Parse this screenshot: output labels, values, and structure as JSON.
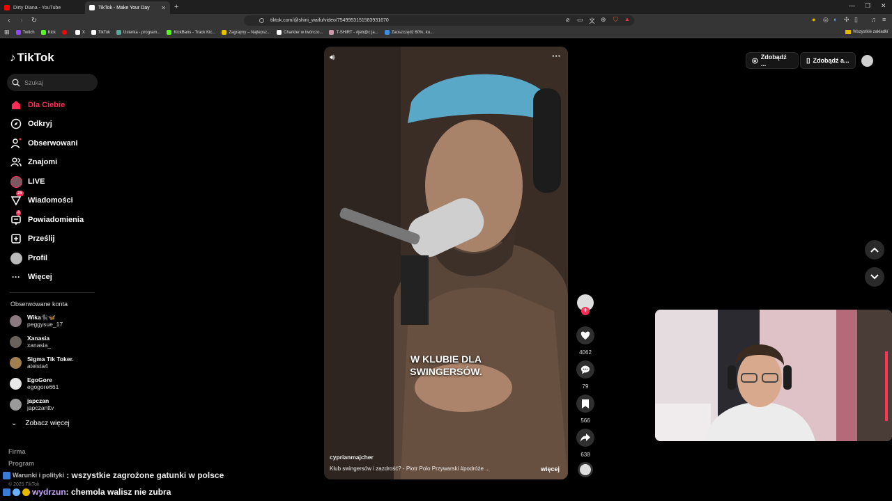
{
  "browser": {
    "tabs": [
      {
        "title": "Dirty Diana - YouTube",
        "active": false,
        "color": "#ff0000"
      },
      {
        "title": "TikTok - Make Your Day",
        "active": true,
        "color": "#ffffff"
      }
    ],
    "url": "tiktok.com/@shini_waifu/video/7549953151583931670",
    "bookmarks": [
      {
        "label": "Twitch",
        "color": "#9146ff"
      },
      {
        "label": "Kick",
        "color": "#53fc18"
      },
      {
        "label": "",
        "color": "#ff0000"
      },
      {
        "label": "X",
        "color": "#ffffff"
      },
      {
        "label": "TikTok",
        "color": "#ffffff"
      },
      {
        "label": "Usterka - program...",
        "color": "#5a9"
      },
      {
        "label": "KickBans - Track Kic...",
        "color": "#53fc18"
      },
      {
        "label": "Zagrajmy – Najlepsz...",
        "color": "#e6c200"
      },
      {
        "label": "Charkter w twórczo...",
        "color": "#ffffff"
      },
      {
        "label": "T-SHIRT - #jeb@c ja...",
        "color": "#c9a"
      },
      {
        "label": "Zaoszczędź 60%, ku...",
        "color": "#3a8ee6"
      }
    ],
    "bookmarks_folder": "Wszystkie zakładki"
  },
  "sidebar": {
    "logo": "TikTok",
    "search_placeholder": "Szukaj",
    "nav": [
      {
        "label": "Dla Ciebie",
        "icon": "home-icon",
        "active": true
      },
      {
        "label": "Odkryj",
        "icon": "compass-icon"
      },
      {
        "label": "Obserwowani",
        "icon": "following-icon"
      },
      {
        "label": "Znajomi",
        "icon": "friends-icon"
      },
      {
        "label": "LIVE",
        "icon": "live-icon"
      },
      {
        "label": "Wiadomości",
        "icon": "messages-icon",
        "badge": "25"
      },
      {
        "label": "Powiadomienia",
        "icon": "notifications-icon",
        "badge": "4"
      },
      {
        "label": "Prześlij",
        "icon": "upload-icon"
      },
      {
        "label": "Profil",
        "icon": "profile-icon"
      },
      {
        "label": "Więcej",
        "icon": "more-icon"
      }
    ],
    "following_title": "Obserwowane konta",
    "accounts": [
      {
        "name": "Wika🐈‍⬛🦋",
        "handle": "peggysue_17"
      },
      {
        "name": "Xanasia",
        "handle": "xanasia_"
      },
      {
        "name": "Sigma Tik Toker.",
        "handle": "ateista4"
      },
      {
        "name": "EgoGore",
        "handle": "egogore661"
      },
      {
        "name": "japczan",
        "handle": "japczanttv"
      }
    ],
    "see_more": "Zobacz więcej",
    "footer": [
      "Firma",
      "Program",
      "Warunki i polityki",
      "© 2025 TikTok"
    ]
  },
  "video": {
    "caption_line1": "W KLUBIE DLA",
    "caption_line2": "SWINGERSÓW.",
    "author": "cyprianmajcher",
    "description": "Klub swingersów i zazdrość? - Piotr Polo Przywarski #podróże ...",
    "more": "więcej"
  },
  "actions": {
    "likes": "4062",
    "comments": "79",
    "saves": "566",
    "shares": "638"
  },
  "top_right": {
    "coins_label": "Zdobądź ...",
    "app_label": "Zdobądź a..."
  },
  "chat": [
    {
      "user": "Warunki i polityki",
      "message": ": wszystkie zagrożone gatunki w polsce",
      "user_color": "#bbbbbb"
    },
    {
      "user": "wydrzun",
      "message": ": chemola walisz nie zubra",
      "user_color": "#c8a2ff"
    }
  ]
}
